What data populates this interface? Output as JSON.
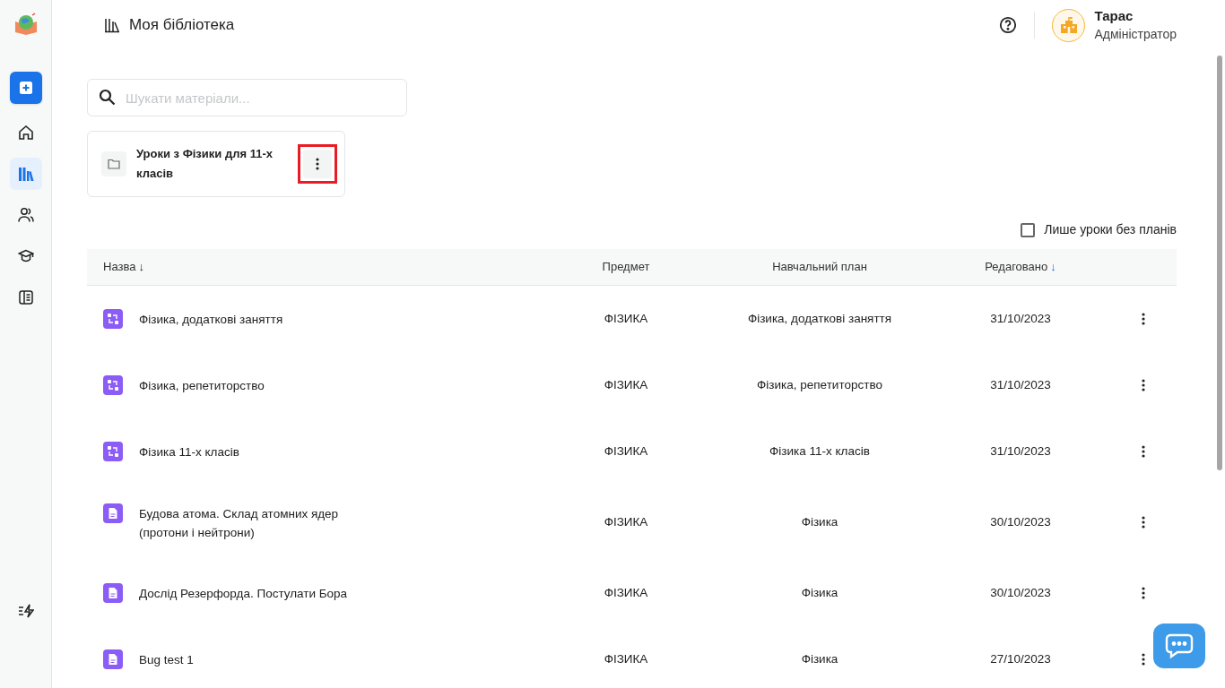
{
  "sidebar": {
    "items": [
      {
        "kind": "create",
        "selected": false
      },
      {
        "kind": "home",
        "selected": false
      },
      {
        "kind": "library",
        "selected": true
      },
      {
        "kind": "people",
        "selected": false
      },
      {
        "kind": "courses",
        "selected": false
      },
      {
        "kind": "journal",
        "selected": false
      }
    ],
    "bottom_item": {
      "kind": "whats-new"
    }
  },
  "header": {
    "title": "Моя бібліотека",
    "user": {
      "name": "Тарас",
      "role": "Адміністратор"
    }
  },
  "search": {
    "placeholder": "Шукати матеріали..."
  },
  "folders": [
    {
      "title": "Уроки з Фізики для 11-х класів",
      "menu_highlighted": true
    }
  ],
  "filter": {
    "label": "Лише уроки без планів",
    "checked": false
  },
  "table": {
    "columns": [
      {
        "label": "Назва",
        "sort_arrow": "↓",
        "sort_active": false
      },
      {
        "label": "Предмет"
      },
      {
        "label": "Навчальний план"
      },
      {
        "label": "Редаговано",
        "sort_arrow": "↓",
        "sort_active": true
      }
    ],
    "rows": [
      {
        "kind": "plan",
        "name": "Фізика, додаткові заняття",
        "subject": "ФІЗИКА",
        "plan": "Фізика, додаткові заняття",
        "edited": "31/10/2023"
      },
      {
        "kind": "plan",
        "name": "Фізика, репетиторство",
        "subject": "ФІЗИКА",
        "plan": "Фізика, репетиторство",
        "edited": "31/10/2023"
      },
      {
        "kind": "plan",
        "name": "Фізика 11-х класів",
        "subject": "ФІЗИКА",
        "plan": "Фізика 11-х класів",
        "edited": "31/10/2023"
      },
      {
        "kind": "lesson",
        "name": "Будова атома. Склад атомних ядер (протони і нейтрони)",
        "subject": "ФІЗИКА",
        "plan": "Фізика",
        "edited": "30/10/2023"
      },
      {
        "kind": "lesson",
        "name": "Дослід Резерфорда. Постулати Бора",
        "subject": "ФІЗИКА",
        "plan": "Фізика",
        "edited": "30/10/2023"
      },
      {
        "kind": "lesson",
        "name": "Bug test 1",
        "subject": "ФІЗИКА",
        "plan": "Фізика",
        "edited": "27/10/2023"
      }
    ]
  }
}
